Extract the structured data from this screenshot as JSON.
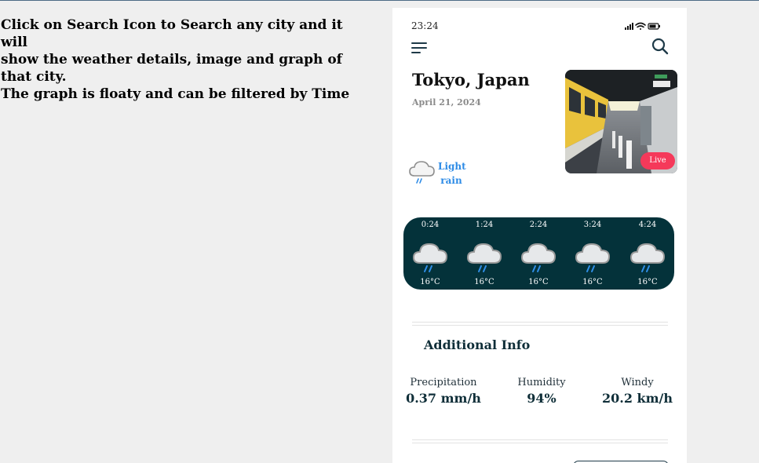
{
  "instructions": {
    "line1": "Click on Search Icon to Search any city and it will",
    "line2": "show the weather details, image and graph of that city.",
    "line3": "The graph is floaty and can be filtered by Time"
  },
  "status_bar": {
    "time": "23:24"
  },
  "header": {
    "menu_icon": "menu-icon",
    "search_icon": "search-icon"
  },
  "location": {
    "city": "Tokyo, Japan",
    "date": "April 21, 2024"
  },
  "photo": {
    "badge": "Live"
  },
  "current": {
    "icon": "rain-cloud-icon",
    "line1": "Light",
    "line2": "rain"
  },
  "forecast": [
    {
      "time": "0:24",
      "temp": "16°C",
      "icon": "rain-cloud-icon"
    },
    {
      "time": "1:24",
      "temp": "16°C",
      "icon": "rain-cloud-icon"
    },
    {
      "time": "2:24",
      "temp": "16°C",
      "icon": "rain-cloud-icon"
    },
    {
      "time": "3:24",
      "temp": "16°C",
      "icon": "rain-cloud-icon"
    },
    {
      "time": "4:24",
      "temp": "16°C",
      "icon": "rain-cloud-icon"
    }
  ],
  "additional": {
    "title": "Additional Info",
    "precipitation": {
      "label": "Precipitation",
      "value": "0.37 mm/h"
    },
    "humidity": {
      "label": "Humidity",
      "value": "94%"
    },
    "windy": {
      "label": "Windy",
      "value": "20.2 km/h"
    }
  },
  "colors": {
    "background": "#efefef",
    "forecast_panel": "#04323a",
    "accent_blue": "#2d8be6",
    "live_badge": "#f5395a",
    "heading": "#0f2e38"
  }
}
